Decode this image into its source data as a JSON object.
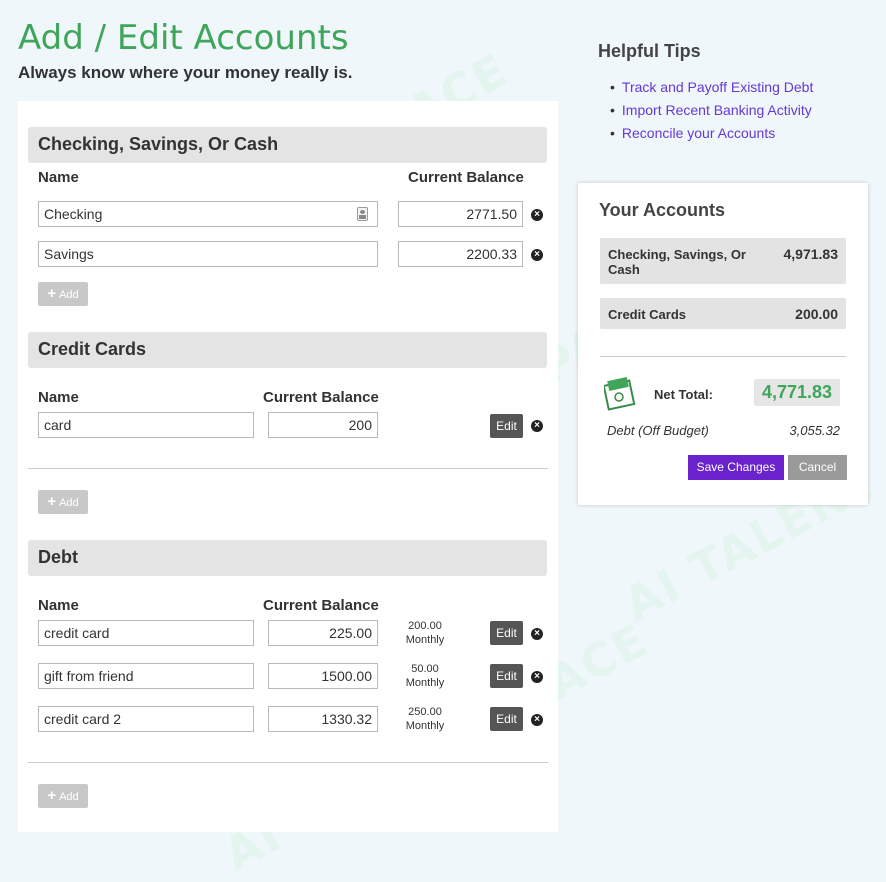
{
  "page": {
    "title": "Add / Edit Accounts",
    "subtitle": "Always know where your money really is."
  },
  "watermark": "AI TALENT SPACE",
  "sections": {
    "checking": {
      "title": "Checking, Savings, Or Cash",
      "name_header": "Name",
      "balance_header": "Current Balance",
      "rows": [
        {
          "name": "Checking",
          "balance": "2771.50"
        },
        {
          "name": "Savings",
          "balance": "2200.33"
        }
      ],
      "add_label": "Add"
    },
    "credit": {
      "title": "Credit Cards",
      "name_header": "Name",
      "balance_header": "Current Balance",
      "rows": [
        {
          "name": "card",
          "balance": "200"
        }
      ],
      "edit_label": "Edit",
      "add_label": "Add"
    },
    "debt": {
      "title": "Debt",
      "name_header": "Name",
      "balance_header": "Current Balance",
      "rows": [
        {
          "name": "credit card",
          "balance": "225.00",
          "payment": "200.00",
          "period": "Monthly"
        },
        {
          "name": "gift from friend",
          "balance": "1500.00",
          "payment": "50.00",
          "period": "Monthly"
        },
        {
          "name": "credit card 2",
          "balance": "1330.32",
          "payment": "250.00",
          "period": "Monthly"
        }
      ],
      "edit_label": "Edit",
      "add_label": "Add"
    }
  },
  "tips": {
    "title": "Helpful Tips",
    "items": [
      "Track and Payoff Existing Debt",
      "Import Recent Banking Activity",
      "Reconcile your Accounts"
    ]
  },
  "summary": {
    "title": "Your Accounts",
    "groups": [
      {
        "name": "Checking, Savings, Or Cash",
        "total": "4,971.83"
      },
      {
        "name": "Credit Cards",
        "total": "200.00"
      }
    ],
    "net_label": "Net Total:",
    "net_value": "4,771.83",
    "debt_label": "Debt (Off Budget)",
    "debt_value": "3,055.32",
    "save_label": "Save Changes",
    "cancel_label": "Cancel"
  },
  "colors": {
    "accent_green": "#3fa55a",
    "link_purple": "#6638d6",
    "save_purple": "#6a22cc"
  },
  "icons": {
    "remove": "remove-icon",
    "add": "plus-icon",
    "contact_card": "contact-card-icon",
    "net_total": "money-stack-icon"
  }
}
